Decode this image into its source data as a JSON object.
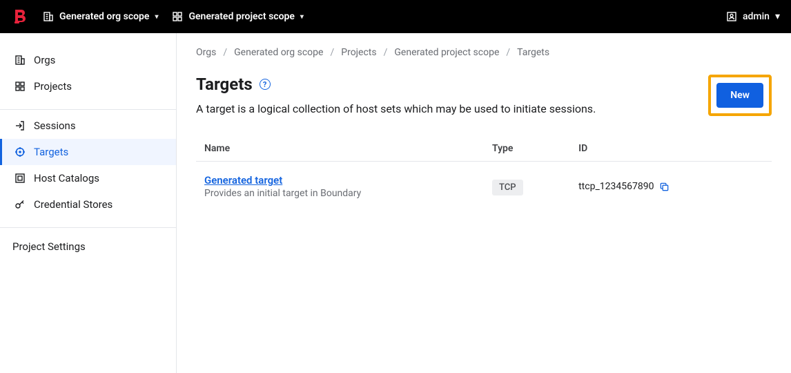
{
  "header": {
    "org_scope_label": "Generated org scope",
    "project_scope_label": "Generated project scope",
    "user_label": "admin"
  },
  "sidebar": {
    "items": [
      {
        "label": "Orgs"
      },
      {
        "label": "Projects"
      },
      {
        "label": "Sessions"
      },
      {
        "label": "Targets"
      },
      {
        "label": "Host Catalogs"
      },
      {
        "label": "Credential Stores"
      }
    ],
    "settings_label": "Project Settings"
  },
  "breadcrumbs": {
    "items": [
      "Orgs",
      "Generated org scope",
      "Projects",
      "Generated project scope",
      "Targets"
    ]
  },
  "page": {
    "title": "Targets",
    "description": "A target is a logical collection of host sets which may be used to initiate sessions.",
    "new_button_label": "New"
  },
  "table": {
    "columns": {
      "name": "Name",
      "type": "Type",
      "id": "ID"
    },
    "rows": [
      {
        "name": "Generated target",
        "desc": "Provides an initial target in Boundary",
        "type": "TCP",
        "id": "ttcp_1234567890"
      }
    ]
  }
}
